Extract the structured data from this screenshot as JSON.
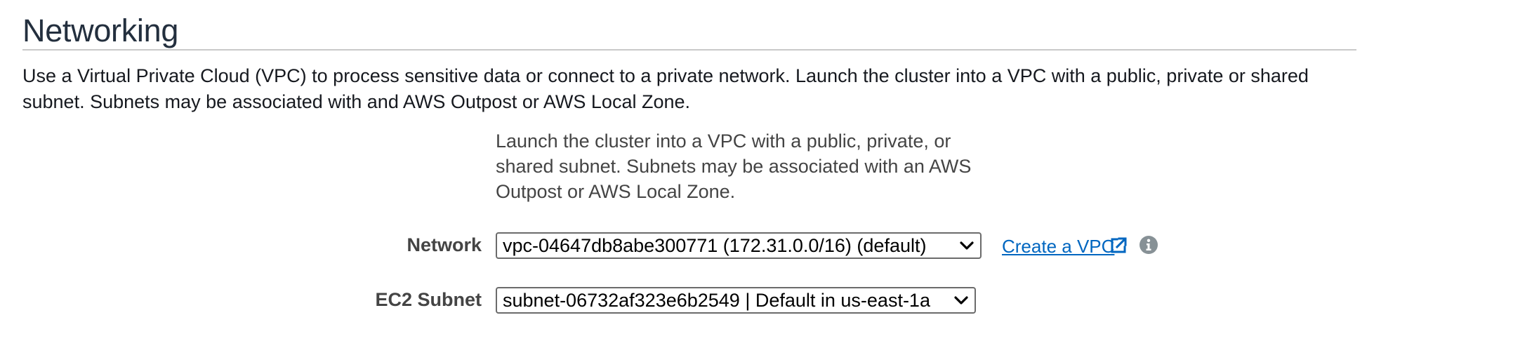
{
  "section": {
    "title": "Networking",
    "description": "Use a Virtual Private Cloud (VPC) to process sensitive data or connect to a private network. Launch the cluster into a VPC with a public, private or shared subnet. Subnets may be associated with and AWS Outpost or AWS Local Zone."
  },
  "form": {
    "help_text": "Launch the cluster into a VPC with a public, private, or shared subnet. Subnets may be associated with an AWS Outpost or AWS Local Zone.",
    "network": {
      "label": "Network",
      "selected": "vpc-04647db8abe300771 (172.31.0.0/16) (default)",
      "create_link": "Create a VPC",
      "external_icon": "external-link-icon",
      "info_icon": "info-icon"
    },
    "subnet": {
      "label": "EC2 Subnet",
      "selected": "subnet-06732af323e6b2549 | Default in us-east-1a"
    }
  },
  "colors": {
    "link": "#0066c0",
    "title": "#232f3e",
    "label": "#444444",
    "info_icon": "#879196"
  }
}
